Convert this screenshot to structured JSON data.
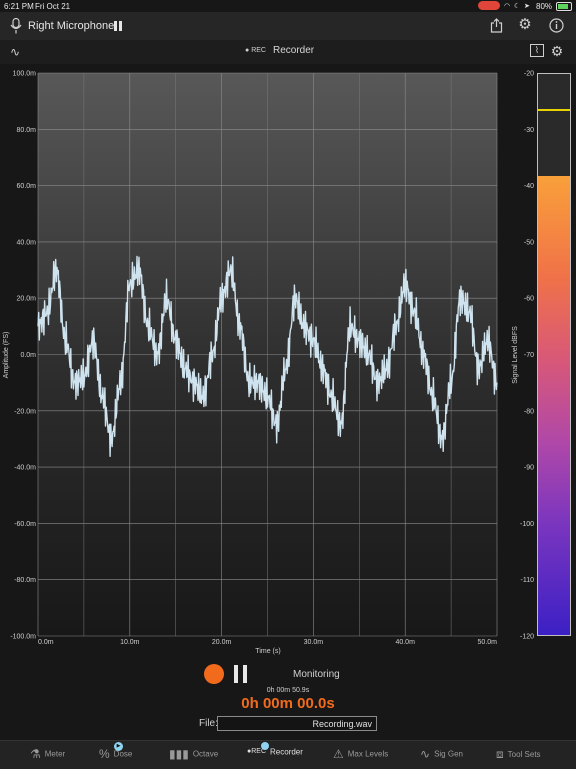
{
  "status_bar": {
    "time": "6:21 PM",
    "date": "Fri Oct 21",
    "battery": "80%",
    "battery_level": 0.8
  },
  "title_bar": {
    "input_label": "Right Microphone"
  },
  "sub_bar": {
    "rec_badge": "REC",
    "mode_title": "Recorder"
  },
  "chart_data": {
    "type": "line",
    "xlabel": "Time (s)",
    "ylabel": "Amplitude (FS)",
    "xlim": [
      0,
      50
    ],
    "ylim": [
      -100,
      100
    ],
    "x_ticks": [
      "0.0m",
      "10.0m",
      "20.0m",
      "30.0m",
      "40.0m",
      "50.0m"
    ],
    "y_ticks": [
      "100.0m",
      "80.0m",
      "60.0m",
      "40.0m",
      "20.0m",
      "0.0m",
      "-20.0m",
      "-40.0m",
      "-60.0m",
      "-80.0m",
      "-100.0m"
    ],
    "grid": true,
    "series": [
      {
        "line_color": "#cfe3ee",
        "x": [
          0,
          1,
          2,
          3,
          4,
          5,
          6,
          7,
          8,
          9,
          10,
          11,
          12,
          13,
          14,
          15,
          16,
          17,
          18,
          19,
          20,
          21,
          22,
          23,
          24,
          25,
          26,
          27,
          28,
          29,
          30,
          31,
          32,
          33,
          34,
          35,
          36,
          37,
          38,
          39,
          40,
          41,
          42,
          43,
          44,
          45,
          46,
          47,
          48,
          49,
          50
        ],
        "values": [
          10,
          15,
          30,
          5,
          -10,
          -8,
          5,
          -15,
          -30,
          -10,
          25,
          30,
          10,
          0,
          20,
          5,
          -5,
          -10,
          -15,
          0,
          20,
          30,
          10,
          -10,
          -10,
          -15,
          -25,
          -5,
          20,
          10,
          5,
          -5,
          -15,
          -25,
          10,
          5,
          0,
          -10,
          -5,
          10,
          25,
          15,
          0,
          -15,
          -30,
          -10,
          20,
          15,
          -5,
          5,
          -10
        ]
      }
    ]
  },
  "meter": {
    "label": "Signal Level dBFS",
    "ticks": [
      "-20",
      "-30",
      "-40",
      "-50",
      "-60",
      "-70",
      "-80",
      "-90",
      "-100",
      "-110",
      "-120"
    ],
    "range": [
      -120,
      -20
    ],
    "level_db": -38.5,
    "peak_db": -26.3
  },
  "controls": {
    "monitor_label": "Monitoring",
    "elapsed_small": "0h 00m 50.9s",
    "elapsed_big": "0h 00m 00.0s",
    "file_label": "File:",
    "file_name": "Recording.wav"
  },
  "tabs": [
    {
      "label": "Meter",
      "icon": "flask-icon"
    },
    {
      "label": "Dose",
      "icon": "dose-icon"
    },
    {
      "label": "Octave",
      "icon": "octave-bars-icon"
    },
    {
      "label": "Recorder",
      "icon": "rec-icon",
      "active": true
    },
    {
      "label": "Max Levels",
      "icon": "warning-icon"
    },
    {
      "label": "Sig Gen",
      "icon": "sine-wave-icon"
    },
    {
      "label": "Tool Sets",
      "icon": "toolbox-icon"
    }
  ],
  "colors": {
    "accent": "#f26b1d",
    "trace": "#cfe3ee",
    "peak": "#e8d200"
  }
}
